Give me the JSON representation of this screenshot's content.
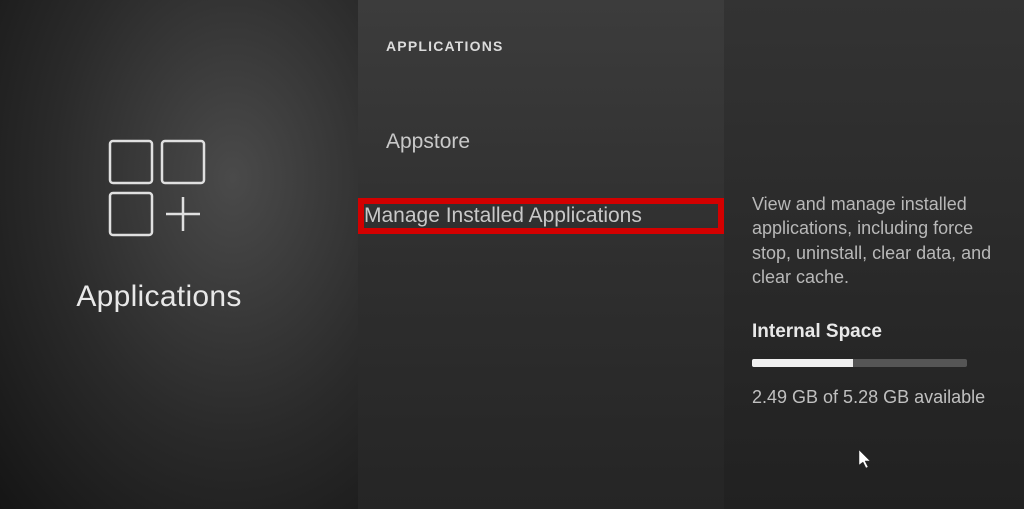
{
  "left": {
    "title": "Applications"
  },
  "middle": {
    "header": "APPLICATIONS",
    "items": [
      {
        "label": "Appstore",
        "selected": false
      },
      {
        "label": "Manage Installed Applications",
        "selected": true
      }
    ]
  },
  "right": {
    "description": "View and manage installed applications, including force stop, uninstall, clear data, and clear cache.",
    "internal_space_label": "Internal Space",
    "storage_text": "2.49 GB of 5.28 GB available",
    "storage_fill_percent": 47
  }
}
